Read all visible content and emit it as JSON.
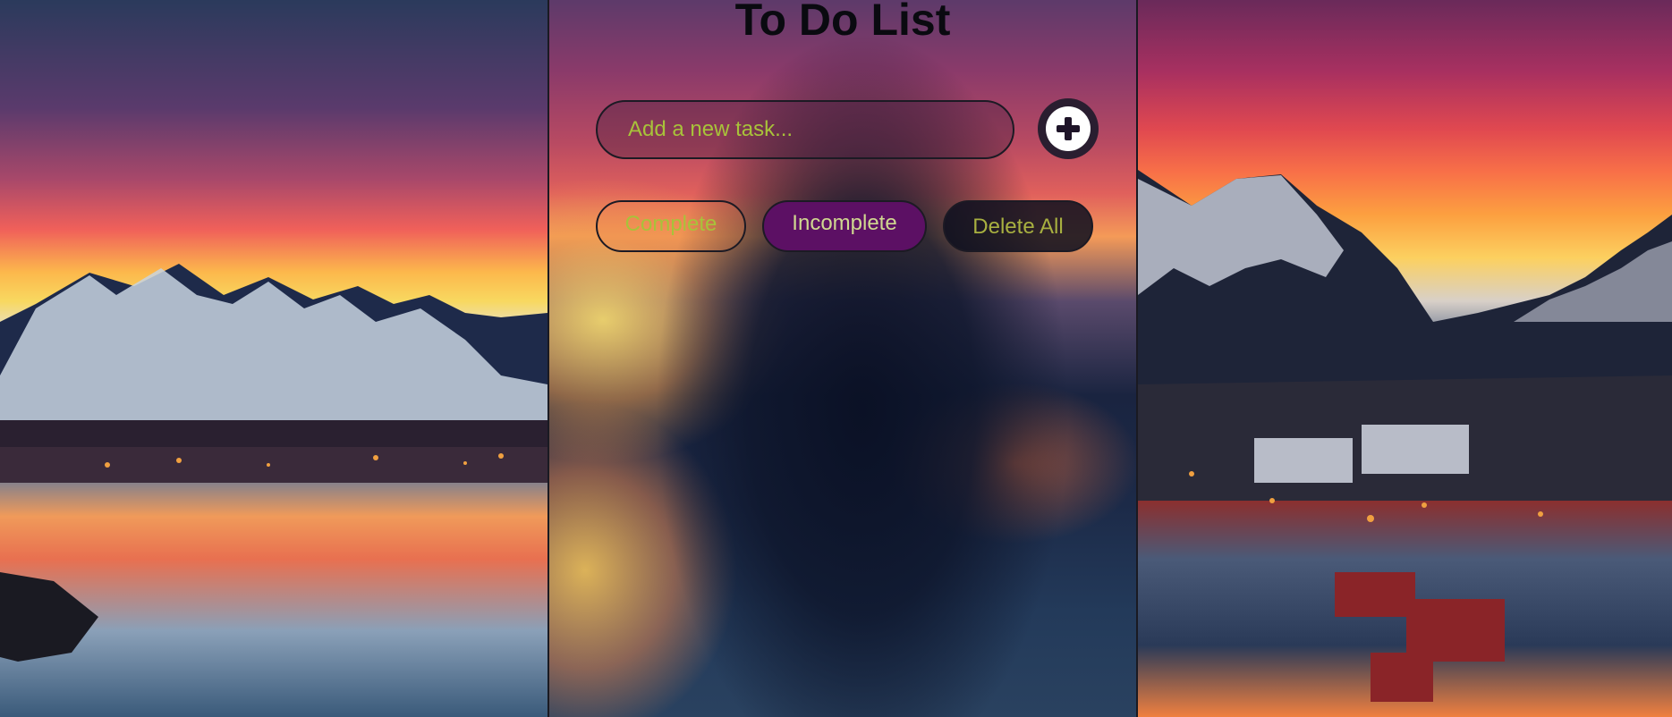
{
  "app": {
    "title": "To Do List"
  },
  "task_input": {
    "placeholder": "Add a new task...",
    "value": ""
  },
  "add_button": {
    "icon": "plus-circle-icon"
  },
  "filters": {
    "complete_label": "Complete",
    "incomplete_label": "Incomplete",
    "delete_all_label": "Delete All"
  },
  "colors": {
    "accent_text": "#a8c23a",
    "active_filter_bg": "#5c1064",
    "title_text": "#0a0a10"
  }
}
